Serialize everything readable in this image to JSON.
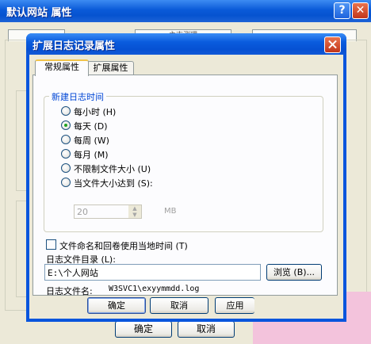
{
  "background_window": {
    "title": "默认网站 属性",
    "help_label": "?",
    "close_label": "✕",
    "tab_partial": "主志测理",
    "ok_label": "确定",
    "cancel_label": "取消"
  },
  "dialog": {
    "title": "扩展日志记录属性",
    "tabs": [
      {
        "label": "常规属性",
        "active": true
      },
      {
        "label": "扩展属性",
        "active": false
      }
    ],
    "group_title": "新建日志时间",
    "schedule_options": [
      {
        "label": "每小时 (H)",
        "selected": false
      },
      {
        "label": "每天 (D)",
        "selected": true
      },
      {
        "label": "每周 (W)",
        "selected": false
      },
      {
        "label": "每月 (M)",
        "selected": false
      },
      {
        "label": "不限制文件大小 (U)",
        "selected": false
      },
      {
        "label": "当文件大小达到 (S):",
        "selected": false
      }
    ],
    "size_value": "20",
    "size_unit": "MB",
    "local_time_checkbox": {
      "label": "文件命名和回卷使用当地时间 (T)",
      "checked": false
    },
    "log_dir_label": "日志文件目录 (L):",
    "log_dir_value": "E:\\个人网站",
    "browse_label": "浏览 (B)...",
    "log_filename_label": "日志文件名:",
    "log_filename_value": "W3SVC1\\exyymmdd.log",
    "buttons": {
      "ok": "确定",
      "cancel": "取消",
      "apply": "应用"
    }
  },
  "colors": {
    "titlebar_blue": "#0a5cde",
    "window_face": "#ece9d8",
    "group_title_blue": "#0046d5",
    "overlay_pink": "#f3c3dc"
  }
}
